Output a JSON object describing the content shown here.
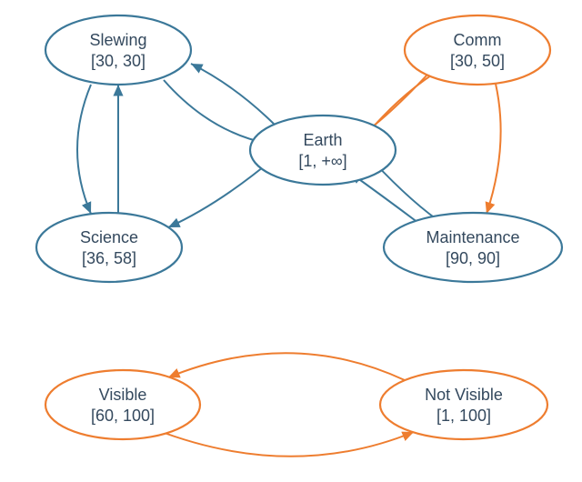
{
  "nodes": {
    "slewing": {
      "label": "Slewing",
      "range": "[30, 30]"
    },
    "comm": {
      "label": "Comm",
      "range": "[30, 50]"
    },
    "earth": {
      "label": "Earth",
      "range": "[1, +∞]"
    },
    "science": {
      "label": "Science",
      "range": "[36, 58]"
    },
    "maintenance": {
      "label": "Maintenance",
      "range": "[90, 90]"
    },
    "visible": {
      "label": "Visible",
      "range": "[60, 100]"
    },
    "notvisible": {
      "label": "Not Visible",
      "range": "[1, 100]"
    }
  },
  "colors": {
    "blue": "#3b7899",
    "orange": "#ee7d2f"
  },
  "edges": [
    {
      "from": "slewing",
      "to": "earth",
      "color": "blue",
      "bidir_pair": "earth-slewing"
    },
    {
      "from": "earth",
      "to": "slewing",
      "color": "blue",
      "bidir_pair": "earth-slewing"
    },
    {
      "from": "slewing",
      "to": "science",
      "color": "blue",
      "bidir_pair": "slewing-science"
    },
    {
      "from": "science",
      "to": "slewing",
      "color": "blue",
      "bidir_pair": "slewing-science"
    },
    {
      "from": "earth",
      "to": "science",
      "color": "blue"
    },
    {
      "from": "earth",
      "to": "comm",
      "color": "orange",
      "bidir_pair": "earth-comm"
    },
    {
      "from": "comm",
      "to": "earth",
      "color": "orange",
      "bidir_pair": "earth-comm"
    },
    {
      "from": "comm",
      "to": "maintenance",
      "color": "orange"
    },
    {
      "from": "earth",
      "to": "maintenance",
      "color": "blue",
      "bidir_pair": "earth-maint"
    },
    {
      "from": "maintenance",
      "to": "earth",
      "color": "blue",
      "bidir_pair": "earth-maint"
    },
    {
      "from": "visible",
      "to": "notvisible",
      "color": "orange",
      "bidir_pair": "vis-notvis"
    },
    {
      "from": "notvisible",
      "to": "visible",
      "color": "orange",
      "bidir_pair": "vis-notvis"
    }
  ]
}
